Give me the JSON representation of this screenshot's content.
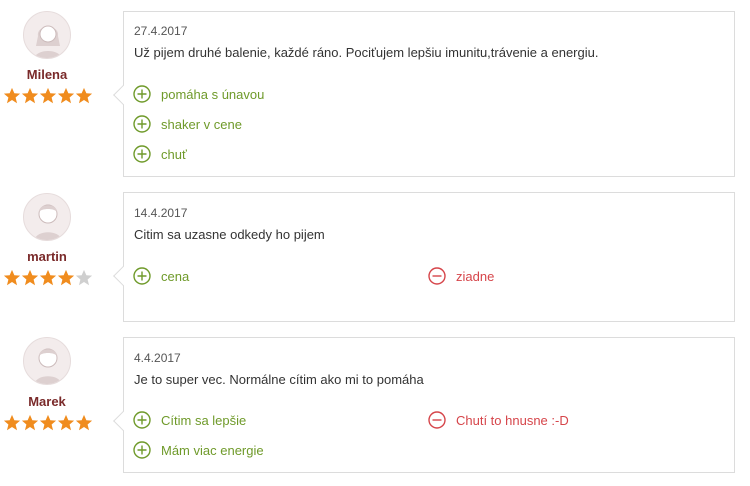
{
  "colors": {
    "pro": "#6f9a2a",
    "con": "#d6454a",
    "star_on": "#f08c1e",
    "star_off": "#cfcfcf",
    "name": "#7a2a2a"
  },
  "reviews": [
    {
      "author": "Milena",
      "avatar": "female-avatar-icon",
      "rating": 5,
      "rating_max": 5,
      "date": "27.4.2017",
      "text": "Už pijem druhé balenie, každé ráno. Pociťujem lepšiu imunitu,trávenie a energiu.",
      "pros": [
        "pomáha s únavou",
        "shaker v cene",
        "chuť"
      ],
      "cons": []
    },
    {
      "author": "martin",
      "avatar": "user-avatar-icon",
      "rating": 4,
      "rating_max": 5,
      "date": "14.4.2017",
      "text": "Citim sa uzasne odkedy ho pijem",
      "pros": [
        "cena"
      ],
      "cons": [
        "ziadne"
      ]
    },
    {
      "author": "Marek",
      "avatar": "user-avatar-icon",
      "rating": 5,
      "rating_max": 5,
      "date": "4.4.2017",
      "text": "Je to super vec. Normálne cítim ako mi to pomáha",
      "pros": [
        "Cítim sa lepšie",
        "Mám viac energie"
      ],
      "cons": [
        "Chutí to hnusne :-D"
      ]
    }
  ]
}
